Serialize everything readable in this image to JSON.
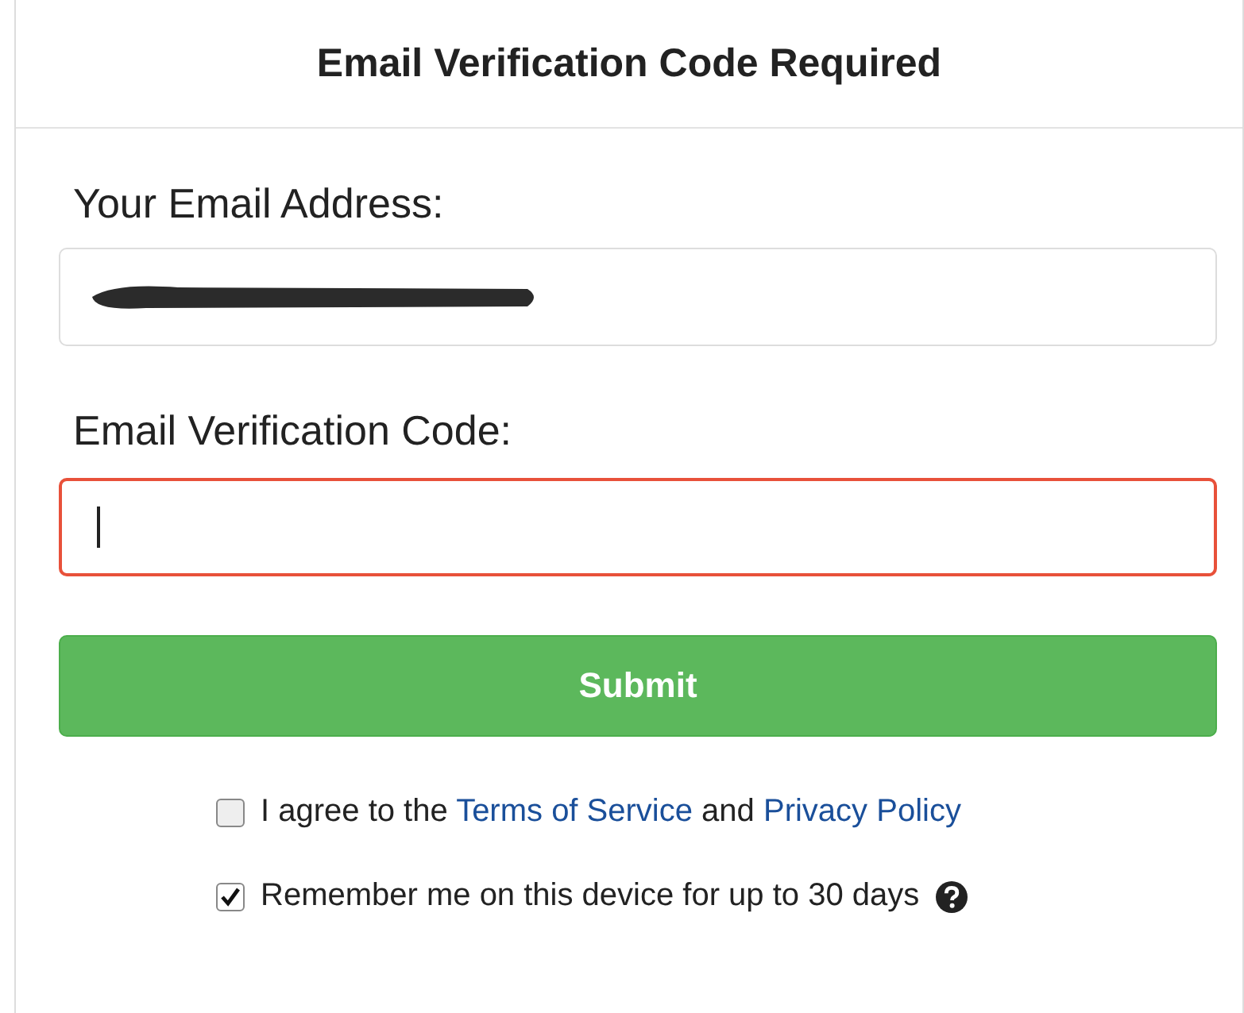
{
  "title": "Email Verification Code Required",
  "email": {
    "label": "Your Email Address:",
    "redacted": true
  },
  "code": {
    "label": "Email Verification Code:",
    "invalid": true
  },
  "submit": {
    "label": "Submit"
  },
  "options": [
    {
      "checked": false,
      "parts": [
        {
          "kind": "text",
          "text": "I agree to the "
        },
        {
          "kind": "link",
          "text": "Terms of Service"
        },
        {
          "kind": "text",
          "text": " and "
        },
        {
          "kind": "link",
          "text": "Privacy Policy"
        }
      ],
      "help": false
    },
    {
      "checked": true,
      "parts": [
        {
          "kind": "text",
          "text": "Remember me on this device for up to 30 days"
        }
      ],
      "help": true
    }
  ]
}
